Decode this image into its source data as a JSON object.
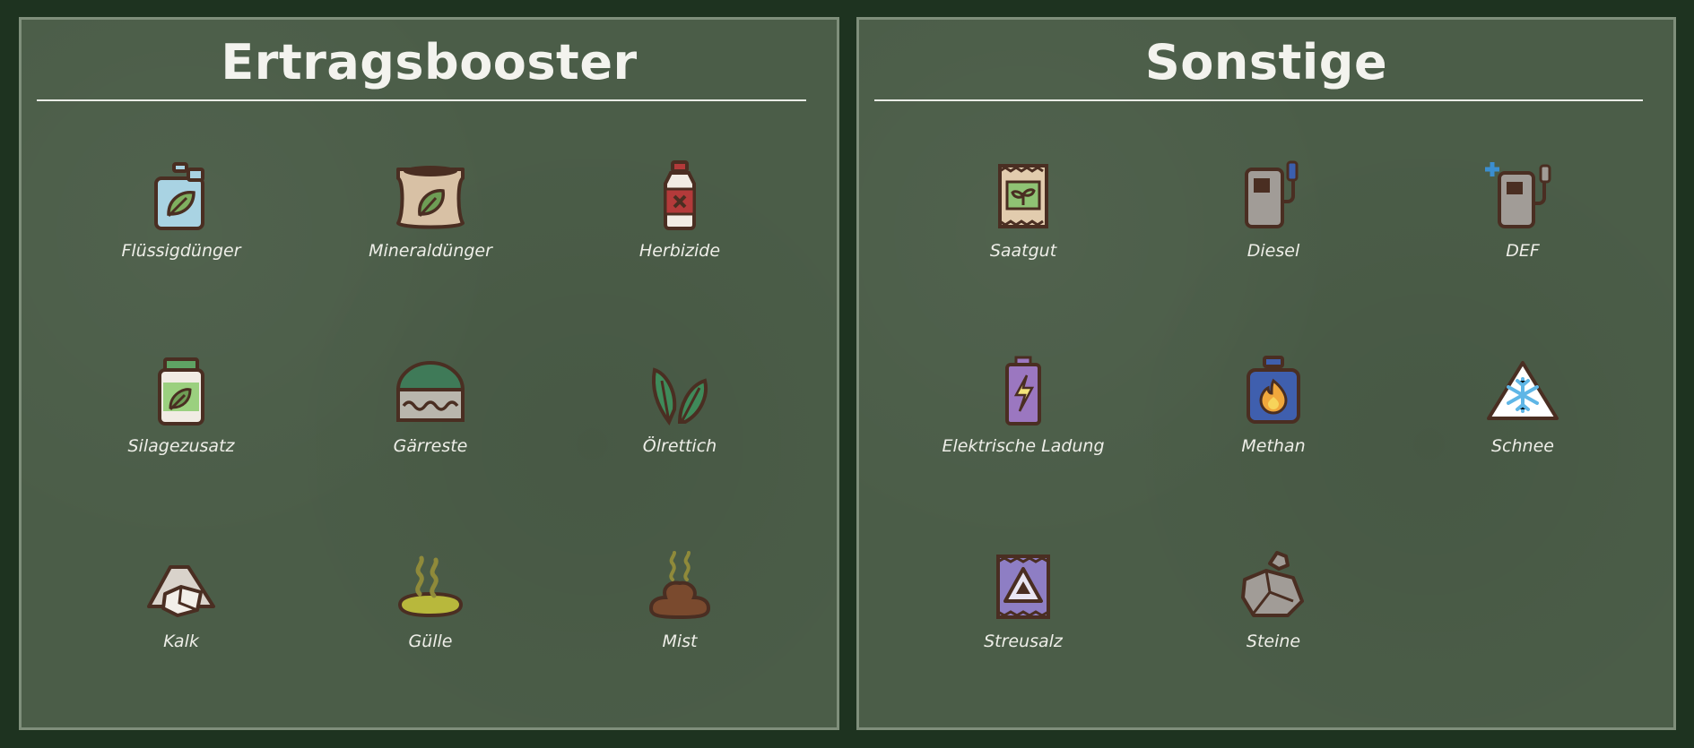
{
  "panels": [
    {
      "title": "Ertragsbooster",
      "items": [
        {
          "label": "Flüssigdünger",
          "icon": "liquid-fertilizer-icon"
        },
        {
          "label": "Mineraldünger",
          "icon": "mineral-fertilizer-icon"
        },
        {
          "label": "Herbizide",
          "icon": "herbicide-icon"
        },
        {
          "label": "Silagezusatz",
          "icon": "silage-additive-icon"
        },
        {
          "label": "Gärreste",
          "icon": "digestate-icon"
        },
        {
          "label": "Ölrettich",
          "icon": "oilseed-radish-icon"
        },
        {
          "label": "Kalk",
          "icon": "lime-icon"
        },
        {
          "label": "Gülle",
          "icon": "slurry-icon"
        },
        {
          "label": "Mist",
          "icon": "manure-icon"
        }
      ]
    },
    {
      "title": "Sonstige",
      "items": [
        {
          "label": "Saatgut",
          "icon": "seed-icon"
        },
        {
          "label": "Diesel",
          "icon": "diesel-pump-icon"
        },
        {
          "label": "DEF",
          "icon": "def-pump-icon"
        },
        {
          "label": "Elektrische Ladung",
          "icon": "battery-icon"
        },
        {
          "label": "Methan",
          "icon": "methane-tank-icon"
        },
        {
          "label": "Schnee",
          "icon": "snow-icon"
        },
        {
          "label": "Streusalz",
          "icon": "road-salt-icon"
        },
        {
          "label": "Steine",
          "icon": "stones-icon"
        }
      ]
    }
  ],
  "colors": {
    "background": "#1e3320",
    "panel": "#4b5d48",
    "panel_border": "#7f8f7b",
    "text": "#eeeee8",
    "icon_outline": "#4a2e22"
  }
}
